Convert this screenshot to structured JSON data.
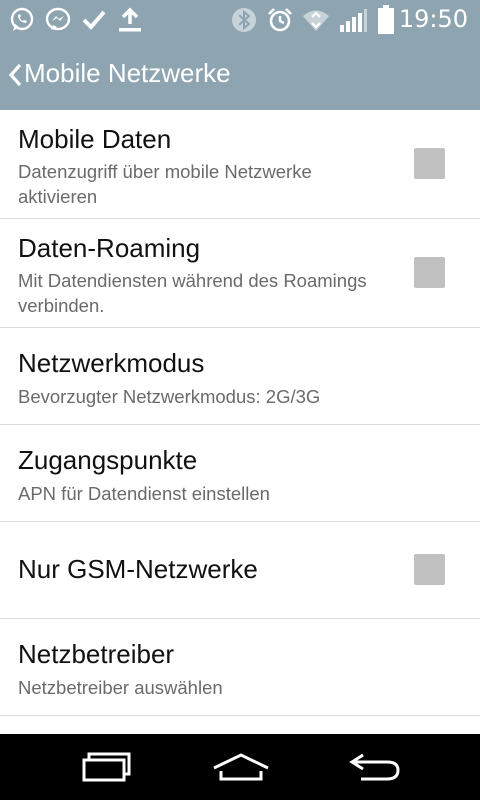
{
  "status_bar": {
    "time": "19:50",
    "left_icons": [
      "whatsapp-icon",
      "messenger-icon",
      "check-icon",
      "download-icon"
    ],
    "right_icons": [
      "bluetooth-icon",
      "alarm-icon",
      "wifi-icon",
      "signal-icon",
      "battery-icon"
    ]
  },
  "action_bar": {
    "title": "Mobile Netzwerke"
  },
  "settings": [
    {
      "title": "Mobile Daten",
      "subtitle": "Datenzugriff über mobile Netzwerke aktivieren",
      "checkbox": true,
      "checked": false
    },
    {
      "title": "Daten-Roaming",
      "subtitle": "Mit Datendiensten während des Roamings verbinden.",
      "checkbox": true,
      "checked": false
    },
    {
      "title": "Netzwerkmodus",
      "subtitle": "Bevorzugter Netzwerkmodus: 2G/3G",
      "checkbox": false
    },
    {
      "title": "Zugangspunkte",
      "subtitle": "APN für Datendienst einstellen",
      "checkbox": false
    },
    {
      "title": "Nur GSM-Netzwerke",
      "subtitle": "",
      "checkbox": true,
      "checked": false
    },
    {
      "title": "Netzbetreiber",
      "subtitle": "Netzbetreiber auswählen",
      "checkbox": false
    }
  ],
  "nav_bar": [
    "recent-apps-icon",
    "home-icon",
    "back-icon"
  ]
}
